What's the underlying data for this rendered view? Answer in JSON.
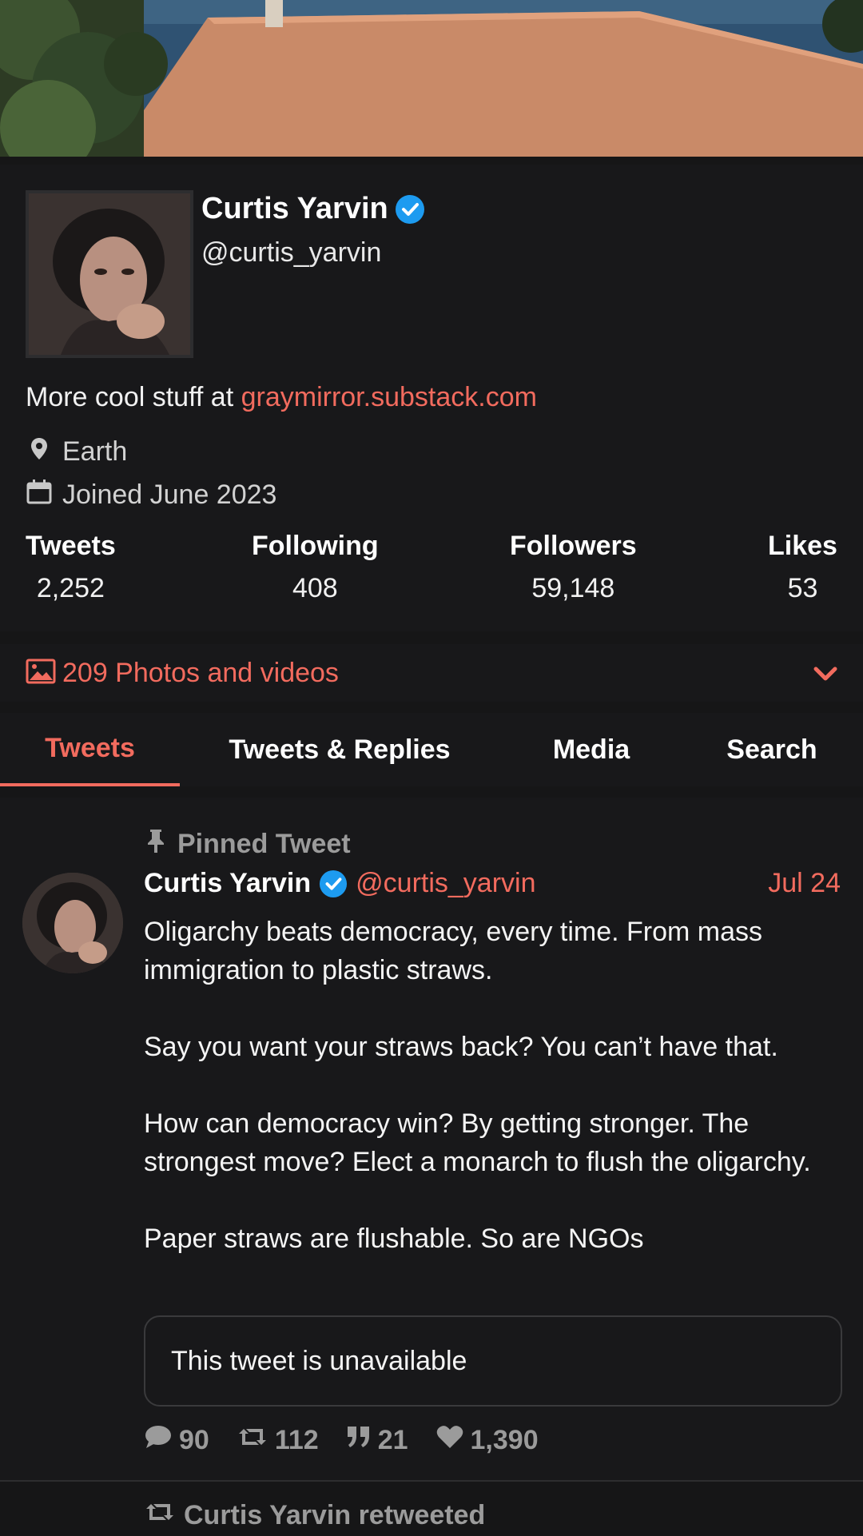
{
  "profile": {
    "fullname": "Curtis Yarvin",
    "username": "@curtis_yarvin",
    "bio_prefix": "More cool stuff at ",
    "bio_link": "graymirror.substack.com",
    "location": "Earth",
    "joined": "Joined June 2023"
  },
  "stats": [
    {
      "label": "Tweets",
      "value": "2,252"
    },
    {
      "label": "Following",
      "value": "408"
    },
    {
      "label": "Followers",
      "value": "59,148"
    },
    {
      "label": "Likes",
      "value": "53"
    }
  ],
  "media_bar": {
    "label": "209 Photos and videos"
  },
  "tabs": [
    {
      "label": "Tweets",
      "active": true
    },
    {
      "label": "Tweets & Replies",
      "active": false
    },
    {
      "label": "Media",
      "active": false
    },
    {
      "label": "Search",
      "active": false
    }
  ],
  "tweet": {
    "pinned_label": "Pinned Tweet",
    "name": "Curtis Yarvin",
    "handle": "@curtis_yarvin",
    "date": "Jul 24",
    "paragraphs": [
      "Oligarchy beats democracy, every time. From mass immigration to plastic straws.",
      "Say you want your straws back? You can’t have that.",
      "How can democracy win? By getting stronger. The strongest move? Elect a monarch to flush the oligarchy.",
      "Paper straws are flushable. So are NGOs"
    ],
    "quote_text": "This tweet is unavailable",
    "replies": "90",
    "retweets": "112",
    "quotes": "21",
    "likes": "1,390"
  },
  "next_item": {
    "retweet_label": "Curtis Yarvin retweeted"
  },
  "colors": {
    "accent": "#f26b5e",
    "background": "#161617",
    "verified": "#1d9bf0"
  }
}
